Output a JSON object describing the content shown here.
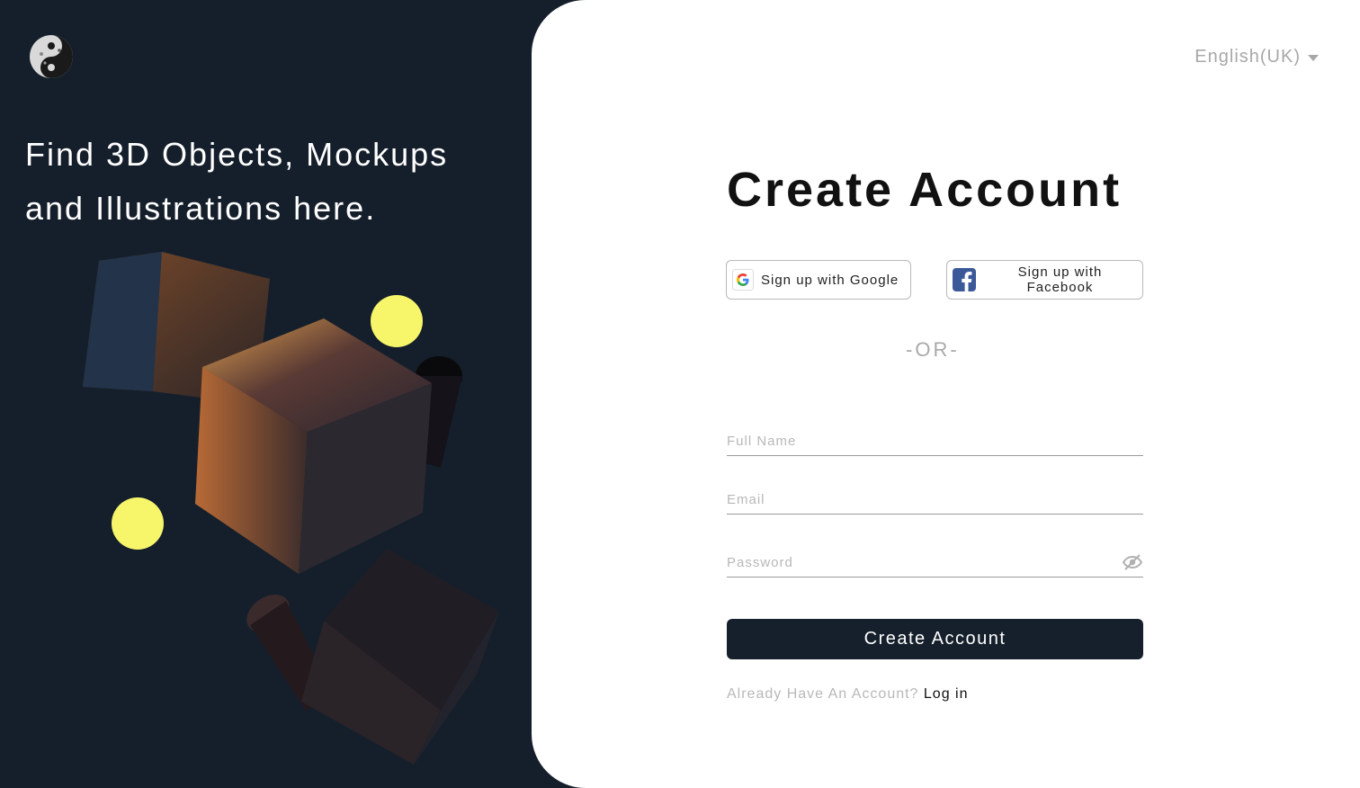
{
  "hero": {
    "tagline_line1": "Find 3D Objects, Mockups",
    "tagline_line2": "and Illustrations here.",
    "logo_icon": "yin-yang-icon",
    "art_icon": "3d-cubes-illustration"
  },
  "header": {
    "language": "English(UK)"
  },
  "form": {
    "title": "Create Account",
    "google_label": "Sign up with Google",
    "facebook_label": "Sign up with Facebook",
    "separator": "-OR-",
    "full_name_placeholder": "Full Name",
    "email_placeholder": "Email",
    "password_placeholder": "Password",
    "submit_label": "Create Account",
    "login_prompt": "Already Have An Account?",
    "login_link": "Log in"
  },
  "colors": {
    "dark_bg": "#16202c",
    "accent_yellow": "#f7f56a",
    "muted_text": "#b8b8b8"
  }
}
